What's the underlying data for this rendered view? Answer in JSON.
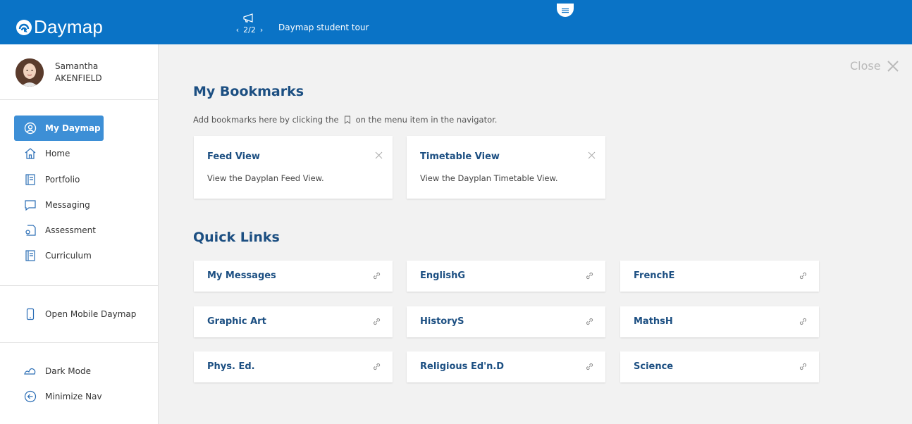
{
  "header": {
    "logo_text": "Daymap",
    "tour_pager": "2/2",
    "tour_title": "Daymap student tour"
  },
  "profile": {
    "first_name": "Samantha",
    "last_name": "AKENFIELD"
  },
  "nav": {
    "items": [
      {
        "label": "My Daymap",
        "icon": "user-circle-icon",
        "active": true
      },
      {
        "label": "Home",
        "icon": "home-icon"
      },
      {
        "label": "Portfolio",
        "icon": "portfolio-icon"
      },
      {
        "label": "Messaging",
        "icon": "chat-icon"
      },
      {
        "label": "Assessment",
        "icon": "assessment-icon"
      },
      {
        "label": "Curriculum",
        "icon": "curriculum-icon"
      }
    ],
    "mobile": "Open Mobile Daymap",
    "dark_mode": "Dark Mode",
    "minimize": "Minimize Nav"
  },
  "main": {
    "close_label": "Close",
    "bookmarks_title": "My Bookmarks",
    "bookmarks_hint_before": "Add bookmarks here by clicking the",
    "bookmarks_hint_after": "on the menu item in the navigator.",
    "bookmarks": [
      {
        "title": "Feed View",
        "desc": "View the Dayplan Feed View."
      },
      {
        "title": "Timetable View",
        "desc": "View the Dayplan Timetable View."
      }
    ],
    "quick_links_title": "Quick Links",
    "quick_links": [
      "My Messages",
      "EnglishG",
      "FrenchE",
      "Graphic Art",
      "HistoryS",
      "MathsH",
      "Phys. Ed.",
      "Religious Ed'n.D",
      "Science"
    ]
  },
  "colors": {
    "header_bg": "#0a73c6",
    "active_nav": "#3d8fd6",
    "link_text": "#1c4f82"
  }
}
